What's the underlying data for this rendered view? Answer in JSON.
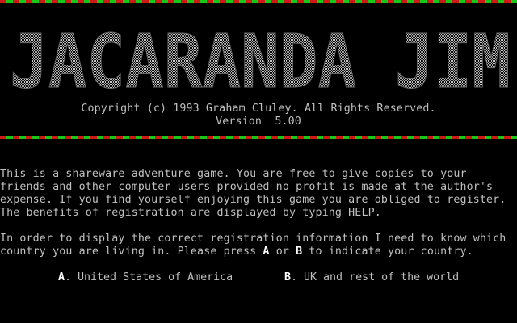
{
  "banner": {
    "text": "JACARANDA JIM"
  },
  "header": {
    "copyright": "Copyright (c) 1993 Graham Cluley. All Rights Reserved.",
    "version": "Version  5.00"
  },
  "intro": [
    "This is a shareware adventure game. You are free to give copies to your",
    "friends and other computer users provided no profit is made at the author's",
    "expense. If you find yourself enjoying this game you are obliged to register.",
    "The benefits of registration are displayed by typing HELP."
  ],
  "country_prompt": {
    "line1": "In order to display the correct registration information I need to know which",
    "line2_pre": "country you are living in. Please press ",
    "key_a": "A",
    "middle": " or ",
    "key_b": "B",
    "line2_post": " to indicate your country."
  },
  "options": [
    {
      "key": "A",
      "label": ". United States of America"
    },
    {
      "key": "B",
      "label": ". UK and rest of the world"
    }
  ],
  "colors": {
    "stripe_red": "#d01818",
    "stripe_green": "#18c818",
    "text": "#c0c0c0",
    "highlight": "#ffffff"
  }
}
